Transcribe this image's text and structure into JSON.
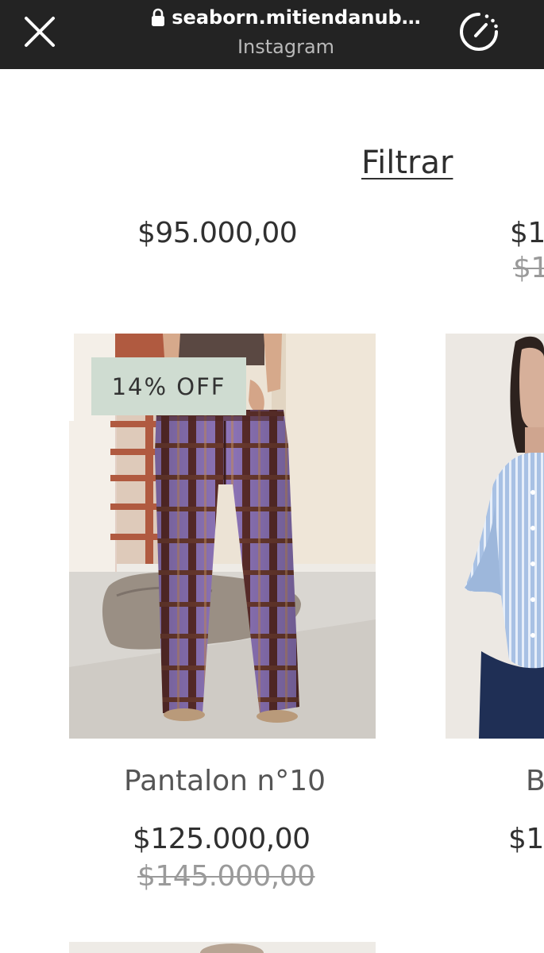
{
  "browser": {
    "url": "seaborn.mitiendanub…",
    "source": "Instagram"
  },
  "filter": {
    "label": "Filtrar"
  },
  "top_row": {
    "left_price": "$95.000,00",
    "right_price_partial": "$1",
    "right_old_price_partial": "$1"
  },
  "products": [
    {
      "badge": "14% OFF",
      "name": "Pantalon n°10",
      "price": "$125.000,00",
      "old_price": "$145.000,00"
    },
    {
      "name_partial": "B",
      "price_partial": "$1"
    }
  ],
  "colors": {
    "topbar": "#232323",
    "badge_bg": "#cfdcd1",
    "plaid_purple": "#8a6fb5",
    "plaid_brown": "#5b2a24"
  }
}
